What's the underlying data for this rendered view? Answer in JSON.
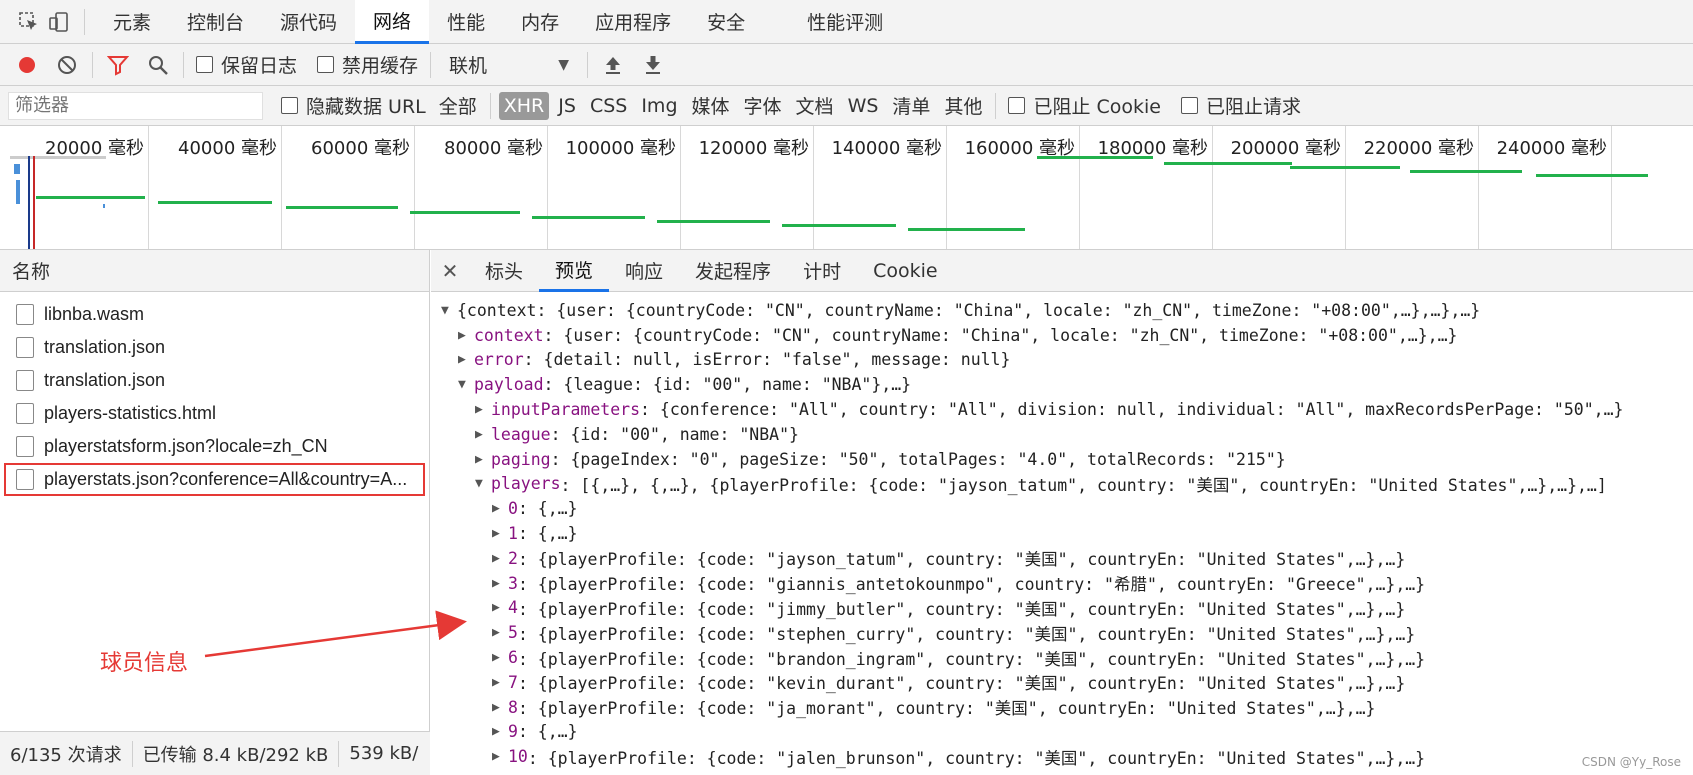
{
  "tabs": [
    {
      "label": "元素",
      "active": false
    },
    {
      "label": "控制台",
      "active": false
    },
    {
      "label": "源代码",
      "active": false
    },
    {
      "label": "网络",
      "active": true
    },
    {
      "label": "性能",
      "active": false
    },
    {
      "label": "内存",
      "active": false
    },
    {
      "label": "应用程序",
      "active": false
    },
    {
      "label": "安全",
      "active": false
    },
    {
      "label": "性能评测",
      "active": false
    }
  ],
  "toolbar": {
    "preserve_log": "保留日志",
    "disable_cache": "禁用缓存",
    "throttle": "联机"
  },
  "filter": {
    "placeholder": "筛选器",
    "hide_data_urls": "隐藏数据 URL",
    "all": "全部",
    "types": [
      "XHR",
      "JS",
      "CSS",
      "Img",
      "媒体",
      "字体",
      "文档",
      "WS",
      "清单",
      "其他"
    ],
    "active_type": "XHR",
    "blocked_cookies": "已阻止 Cookie",
    "blocked_requests": "已阻止请求"
  },
  "timeline": {
    "labels": [
      "20000 毫秒",
      "40000 毫秒",
      "60000 毫秒",
      "80000 毫秒",
      "100000 毫秒",
      "120000 毫秒",
      "140000 毫秒",
      "160000 毫秒",
      "180000 毫秒",
      "200000 毫秒",
      "220000 毫秒",
      "240000 毫秒"
    ],
    "bar_color": "#22b14c"
  },
  "requests": {
    "header": "名称",
    "items": [
      "libnba.wasm",
      "translation.json",
      "translation.json",
      "players-statistics.html",
      "playerstatsform.json?locale=zh_CN",
      "playerstats.json?conference=All&country=A..."
    ],
    "selected_index": 5
  },
  "status": {
    "count": "6/135 次请求",
    "transferred": "已传输 8.4 kB/292 kB",
    "resources": "539 kB/"
  },
  "detail_tabs": [
    {
      "label": "标头",
      "active": false
    },
    {
      "label": "预览",
      "active": true
    },
    {
      "label": "响应",
      "active": false
    },
    {
      "label": "发起程序",
      "active": false
    },
    {
      "label": "计时",
      "active": false
    },
    {
      "label": "Cookie",
      "active": false
    }
  ],
  "preview_lines": [
    {
      "indent": 0,
      "arrow": "▼",
      "key": "",
      "value": "{context: {user: {countryCode: \"CN\", countryName: \"China\", locale: \"zh_CN\", timeZone: \"+08:00\",…},…},…}"
    },
    {
      "indent": 1,
      "arrow": "▶",
      "key": "context",
      "value": ": {user: {countryCode: \"CN\", countryName: \"China\", locale: \"zh_CN\", timeZone: \"+08:00\",…},…}"
    },
    {
      "indent": 1,
      "arrow": "▶",
      "key": "error",
      "value": ": {detail: null, isError: \"false\", message: null}"
    },
    {
      "indent": 1,
      "arrow": "▼",
      "key": "payload",
      "value": ": {league: {id: \"00\", name: \"NBA\"},…}"
    },
    {
      "indent": 2,
      "arrow": "▶",
      "key": "inputParameters",
      "value": ": {conference: \"All\", country: \"All\", division: null, individual: \"All\", maxRecordsPerPage: \"50\",…}"
    },
    {
      "indent": 2,
      "arrow": "▶",
      "key": "league",
      "value": ": {id: \"00\", name: \"NBA\"}"
    },
    {
      "indent": 2,
      "arrow": "▶",
      "key": "paging",
      "value": ": {pageIndex: \"0\", pageSize: \"50\", totalPages: \"4.0\", totalRecords: \"215\"}"
    },
    {
      "indent": 2,
      "arrow": "▼",
      "key": "players",
      "value": ": [{,…}, {,…}, {playerProfile: {code: \"jayson_tatum\", country: \"美国\", countryEn: \"United States\",…},…},…]"
    },
    {
      "indent": 3,
      "arrow": "▶",
      "key": "0",
      "value": ": {,…}"
    },
    {
      "indent": 3,
      "arrow": "▶",
      "key": "1",
      "value": ": {,…}"
    },
    {
      "indent": 3,
      "arrow": "▶",
      "key": "2",
      "value": ": {playerProfile: {code: \"jayson_tatum\", country: \"美国\", countryEn: \"United States\",…},…}"
    },
    {
      "indent": 3,
      "arrow": "▶",
      "key": "3",
      "value": ": {playerProfile: {code: \"giannis_antetokounmpo\", country: \"希腊\", countryEn: \"Greece\",…},…}"
    },
    {
      "indent": 3,
      "arrow": "▶",
      "key": "4",
      "value": ": {playerProfile: {code: \"jimmy_butler\", country: \"美国\", countryEn: \"United States\",…},…}"
    },
    {
      "indent": 3,
      "arrow": "▶",
      "key": "5",
      "value": ": {playerProfile: {code: \"stephen_curry\", country: \"美国\", countryEn: \"United States\",…},…}"
    },
    {
      "indent": 3,
      "arrow": "▶",
      "key": "6",
      "value": ": {playerProfile: {code: \"brandon_ingram\", country: \"美国\", countryEn: \"United States\",…},…}"
    },
    {
      "indent": 3,
      "arrow": "▶",
      "key": "7",
      "value": ": {playerProfile: {code: \"kevin_durant\", country: \"美国\", countryEn: \"United States\",…},…}"
    },
    {
      "indent": 3,
      "arrow": "▶",
      "key": "8",
      "value": ": {playerProfile: {code: \"ja_morant\", country: \"美国\", countryEn: \"United States\",…},…}"
    },
    {
      "indent": 3,
      "arrow": "▶",
      "key": "9",
      "value": ": {,…}"
    },
    {
      "indent": 3,
      "arrow": "▶",
      "key": "10",
      "value": ": {playerProfile: {code: \"jalen_brunson\", country: \"美国\", countryEn: \"United States\",…},…}"
    }
  ],
  "annotation": {
    "label": "球员信息",
    "color": "#e53935"
  },
  "watermark": "CSDN @Yy_Rose",
  "colors": {
    "record": "#e53935",
    "filter": "#e53935",
    "accent": "#1a73e8",
    "key": "#881280"
  }
}
